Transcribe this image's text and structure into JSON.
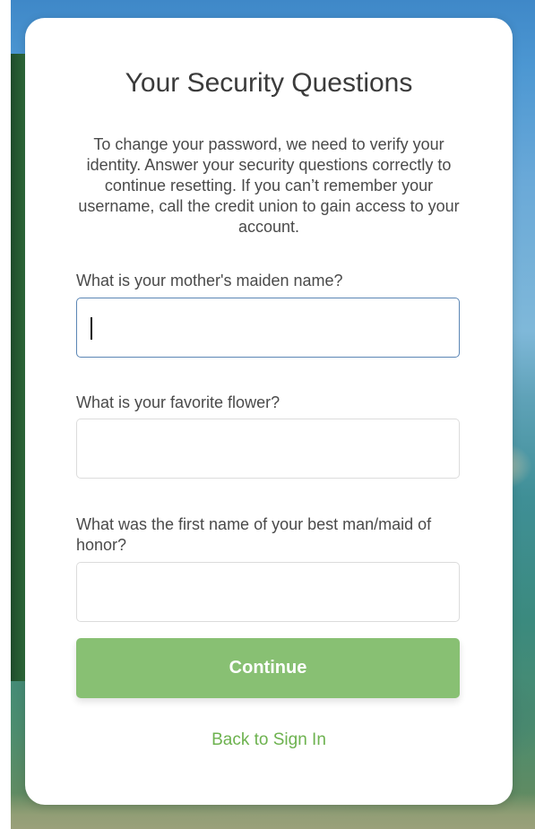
{
  "header": {
    "title": "Your Security Questions",
    "intro": "To change your password, we need to verify your identity. Answer your security questions correctly to continue resetting. If you can’t remember your username, call the credit union to gain access to your account."
  },
  "questions": [
    {
      "label": "What is your mother's maiden name?",
      "value": "",
      "placeholder": ""
    },
    {
      "label": "What is your favorite flower?",
      "value": "",
      "placeholder": ""
    },
    {
      "label": "What was the first name of your best man/maid of honor?",
      "value": "",
      "placeholder": ""
    }
  ],
  "actions": {
    "continue_label": "Continue",
    "back_label": "Back to Sign In"
  },
  "colors": {
    "primary_button": "#88c073",
    "link": "#6db24f",
    "focus_border": "#5b86b5"
  }
}
